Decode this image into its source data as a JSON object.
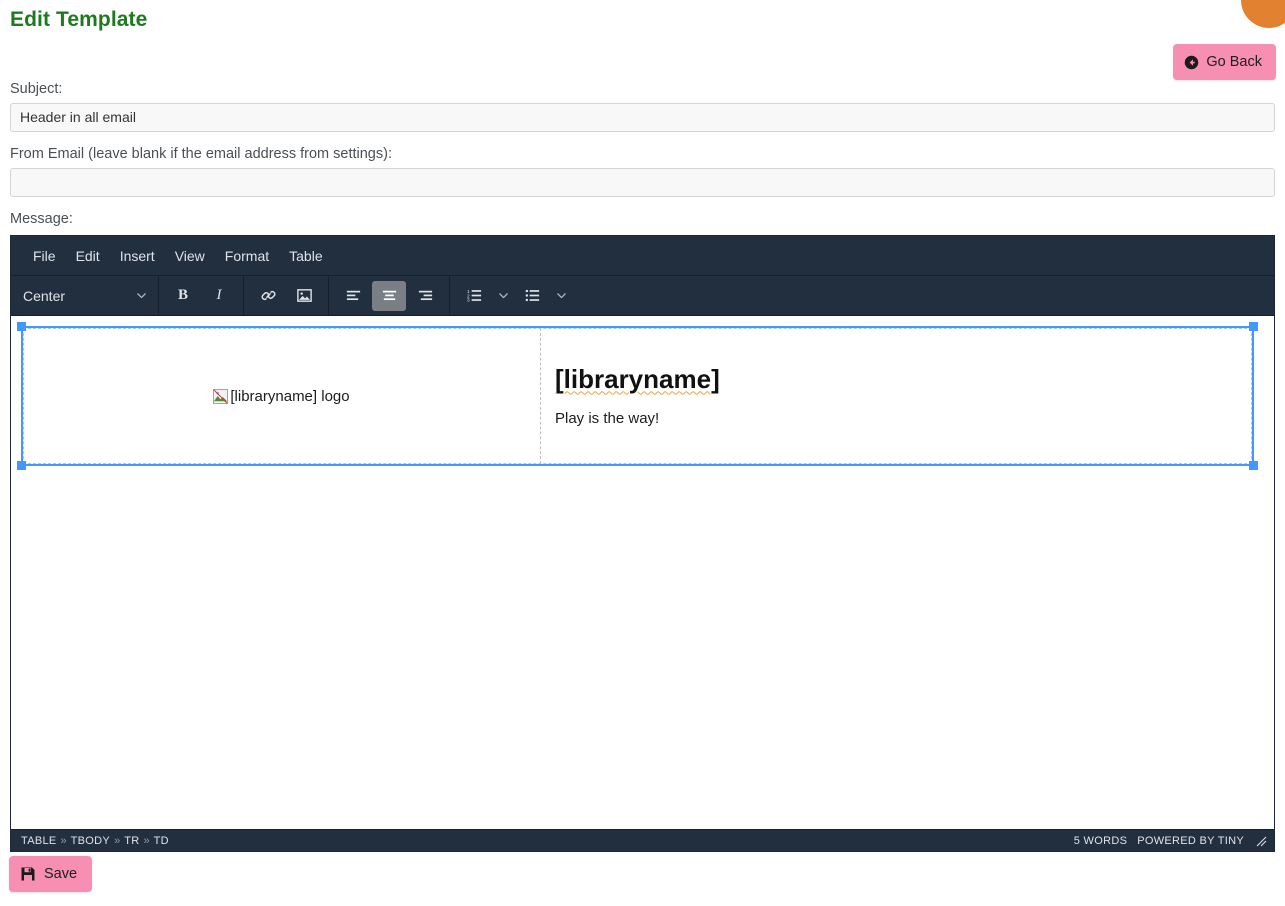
{
  "page": {
    "title": "Edit Template"
  },
  "header": {
    "go_back_label": "Go Back",
    "go_back_icon": "arrow-circle-left-icon",
    "accent_pink": "#f78fb3",
    "accent_green": "#1e7a1e",
    "accent_orange": "#e2812f"
  },
  "form": {
    "subject": {
      "label": "Subject:",
      "value": "Header in all email",
      "placeholder": ""
    },
    "from_email": {
      "label": "From Email (leave blank if the email address from settings):",
      "value": "",
      "placeholder": ""
    },
    "message": {
      "label": "Message:"
    }
  },
  "editor": {
    "menubar": [
      {
        "label": "File"
      },
      {
        "label": "Edit"
      },
      {
        "label": "Insert"
      },
      {
        "label": "View"
      },
      {
        "label": "Format"
      },
      {
        "label": "Table"
      }
    ],
    "toolbar": {
      "format_select": {
        "value": "Center",
        "icon": "chevron-down-icon"
      },
      "bold_label": "B",
      "italic_label": "I",
      "link_icon": "link-icon",
      "image_icon": "image-icon",
      "align_left_icon": "align-left-icon",
      "align_center_icon": "align-center-icon",
      "align_right_icon": "align-right-icon",
      "numbered_list_icon": "numbered-list-icon",
      "bullet_list_icon": "bullet-list-icon",
      "active_button": "align-center"
    },
    "content": {
      "logo_alt": "[libraryname] logo",
      "heading": "[libraryname]",
      "subtext": "Play is the way!"
    },
    "statusbar": {
      "breadcrumb": [
        "TABLE",
        "TBODY",
        "TR",
        "TD"
      ],
      "separator": "»",
      "word_count": "5 WORDS",
      "branding": "POWERED BY TINY",
      "resize_icon": "resize-grip-icon"
    },
    "chrome_color": "#222f3e",
    "selection_color": "#4099ff"
  },
  "footer": {
    "save_label": "Save",
    "save_icon": "floppy-disk-icon"
  }
}
